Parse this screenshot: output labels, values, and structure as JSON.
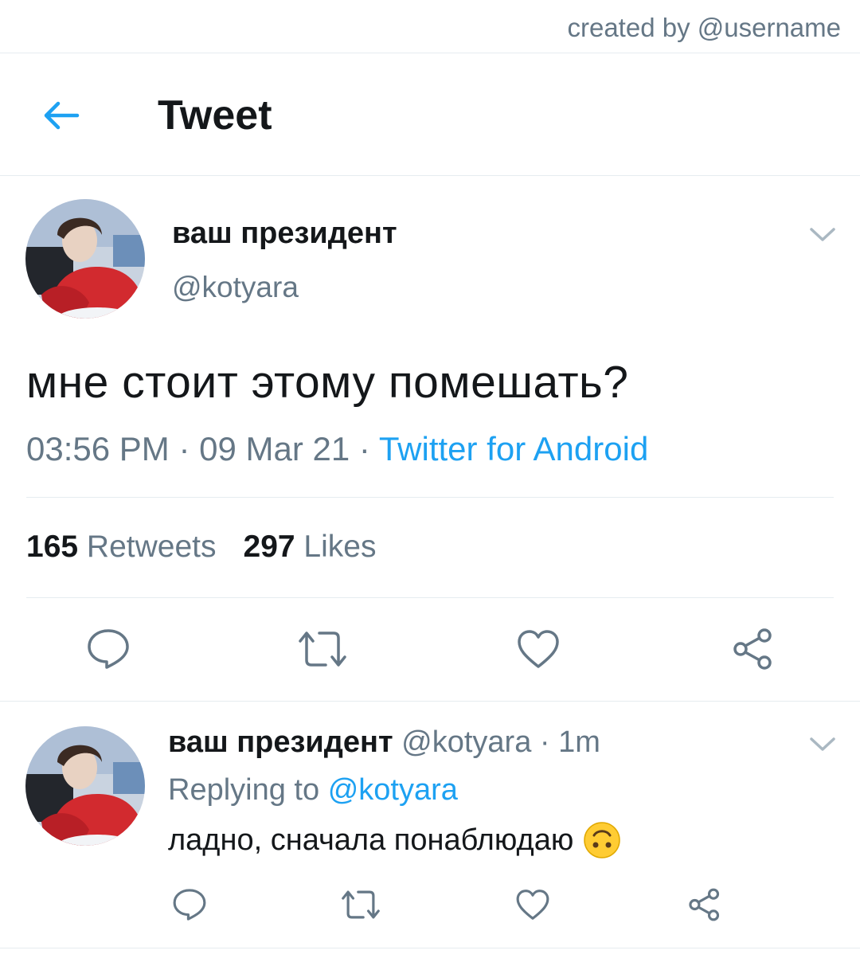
{
  "watermark": "created by @username",
  "header": {
    "title": "Tweet"
  },
  "tweet": {
    "author_name": "ваш президент",
    "author_handle": "@kotyara",
    "text": "мне стоит этому помешать?",
    "time": "03:56 PM",
    "date": "09 Mar 21",
    "separator": "·",
    "source": "Twitter for Android",
    "retweets_count": "165",
    "retweets_label": "Retweets",
    "likes_count": "297",
    "likes_label": "Likes"
  },
  "reply": {
    "author_name": "ваш президент",
    "author_handle": "@kotyara",
    "separator": "·",
    "time": "1m",
    "replying_prefix": "Replying to",
    "replying_to": "@kotyara",
    "text": "ладно, сначала понаблюдаю",
    "emoji_icon": "upside-down-face-icon"
  },
  "colors": {
    "accent": "#1da1f2",
    "text_primary": "#14171a",
    "text_secondary": "#657786",
    "divider": "#e6ecf0",
    "icon": "#657786"
  }
}
